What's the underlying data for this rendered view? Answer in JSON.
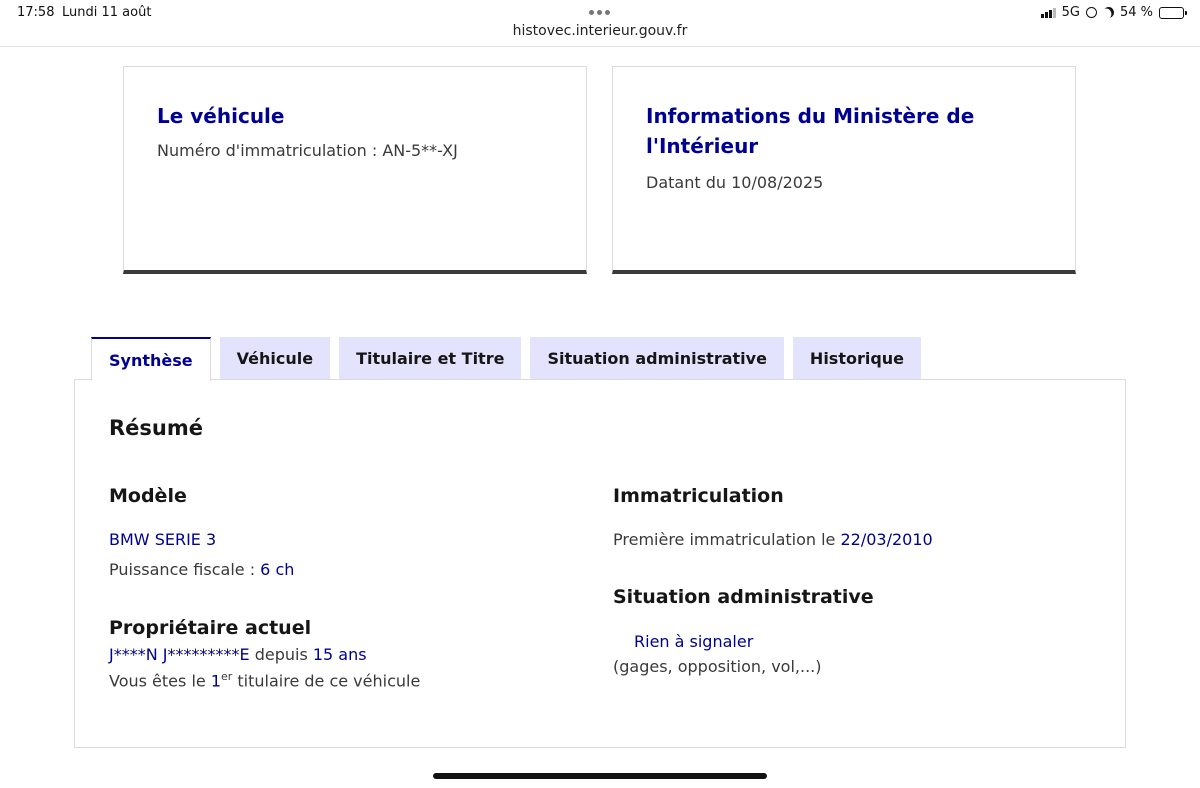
{
  "status_bar": {
    "time": "17:58",
    "date": "Lundi 11 août",
    "network": "5G",
    "battery": "54 %",
    "battery_level": 0.54
  },
  "browser": {
    "url": "histovec.interieur.gouv.fr"
  },
  "cards": {
    "vehicle": {
      "title": "Le véhicule",
      "plate_label": "Numéro d'immatriculation : ",
      "plate_value": "AN-5**-XJ"
    },
    "ministry": {
      "title_line1": "Informations du Ministère de",
      "title_line2": "l'Intérieur",
      "date_label": "Datant du ",
      "date_value": "10/08/2025"
    }
  },
  "tabs": [
    {
      "label": "Synthèse",
      "active": true
    },
    {
      "label": "Véhicule",
      "active": false
    },
    {
      "label": "Titulaire et Titre",
      "active": false
    },
    {
      "label": "Situation administrative",
      "active": false
    },
    {
      "label": "Historique",
      "active": false
    }
  ],
  "summary": {
    "heading": "Résumé",
    "model": {
      "heading": "Modèle",
      "name": "BMW SERIE 3",
      "power_label": "Puissance fiscale : ",
      "power_value": "6 ch"
    },
    "owner": {
      "heading": "Propriétaire actuel",
      "name": "J****N J*********E",
      "since_label": " depuis ",
      "since_value": "15 ans",
      "rank_prefix": "Vous êtes le ",
      "rank_number": "1",
      "rank_sup": "er",
      "rank_suffix": " titulaire de ce véhicule"
    },
    "registration": {
      "heading": "Immatriculation",
      "first_label": "Première immatriculation le ",
      "first_date": "22/03/2010"
    },
    "admin": {
      "heading": "Situation administrative",
      "status": "Rien à signaler",
      "note": "(gages, opposition, vol,...)"
    }
  }
}
